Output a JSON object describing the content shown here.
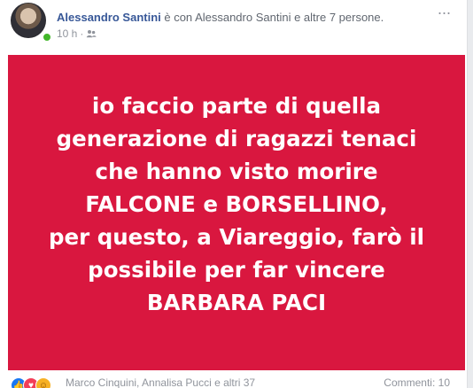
{
  "post": {
    "author": {
      "name": "Alessandro Santini",
      "with_text": " è con ",
      "tagged_name": "Alessandro Santini",
      "tail_text": " e altre 7 persone."
    },
    "meta": {
      "time": "10 h",
      "separator": "·",
      "audience_icon": "friends-icon"
    },
    "more_label": "···",
    "card": {
      "background": "#d9173f",
      "lines": [
        "io faccio parte di quella",
        "generazione di ragazzi tenaci",
        "che hanno visto morire",
        "FALCONE e BORSELLINO,",
        "per questo, a Viareggio, farò il",
        "possibile per far vincere",
        "BARBARA PACI"
      ]
    },
    "footer": {
      "reactions": [
        "like-icon",
        "love-icon",
        "haha-icon"
      ],
      "reaction_names": "Marco Cinquini, Annalisa Pucci e altri 37",
      "comments": "Commenti: 10"
    }
  }
}
